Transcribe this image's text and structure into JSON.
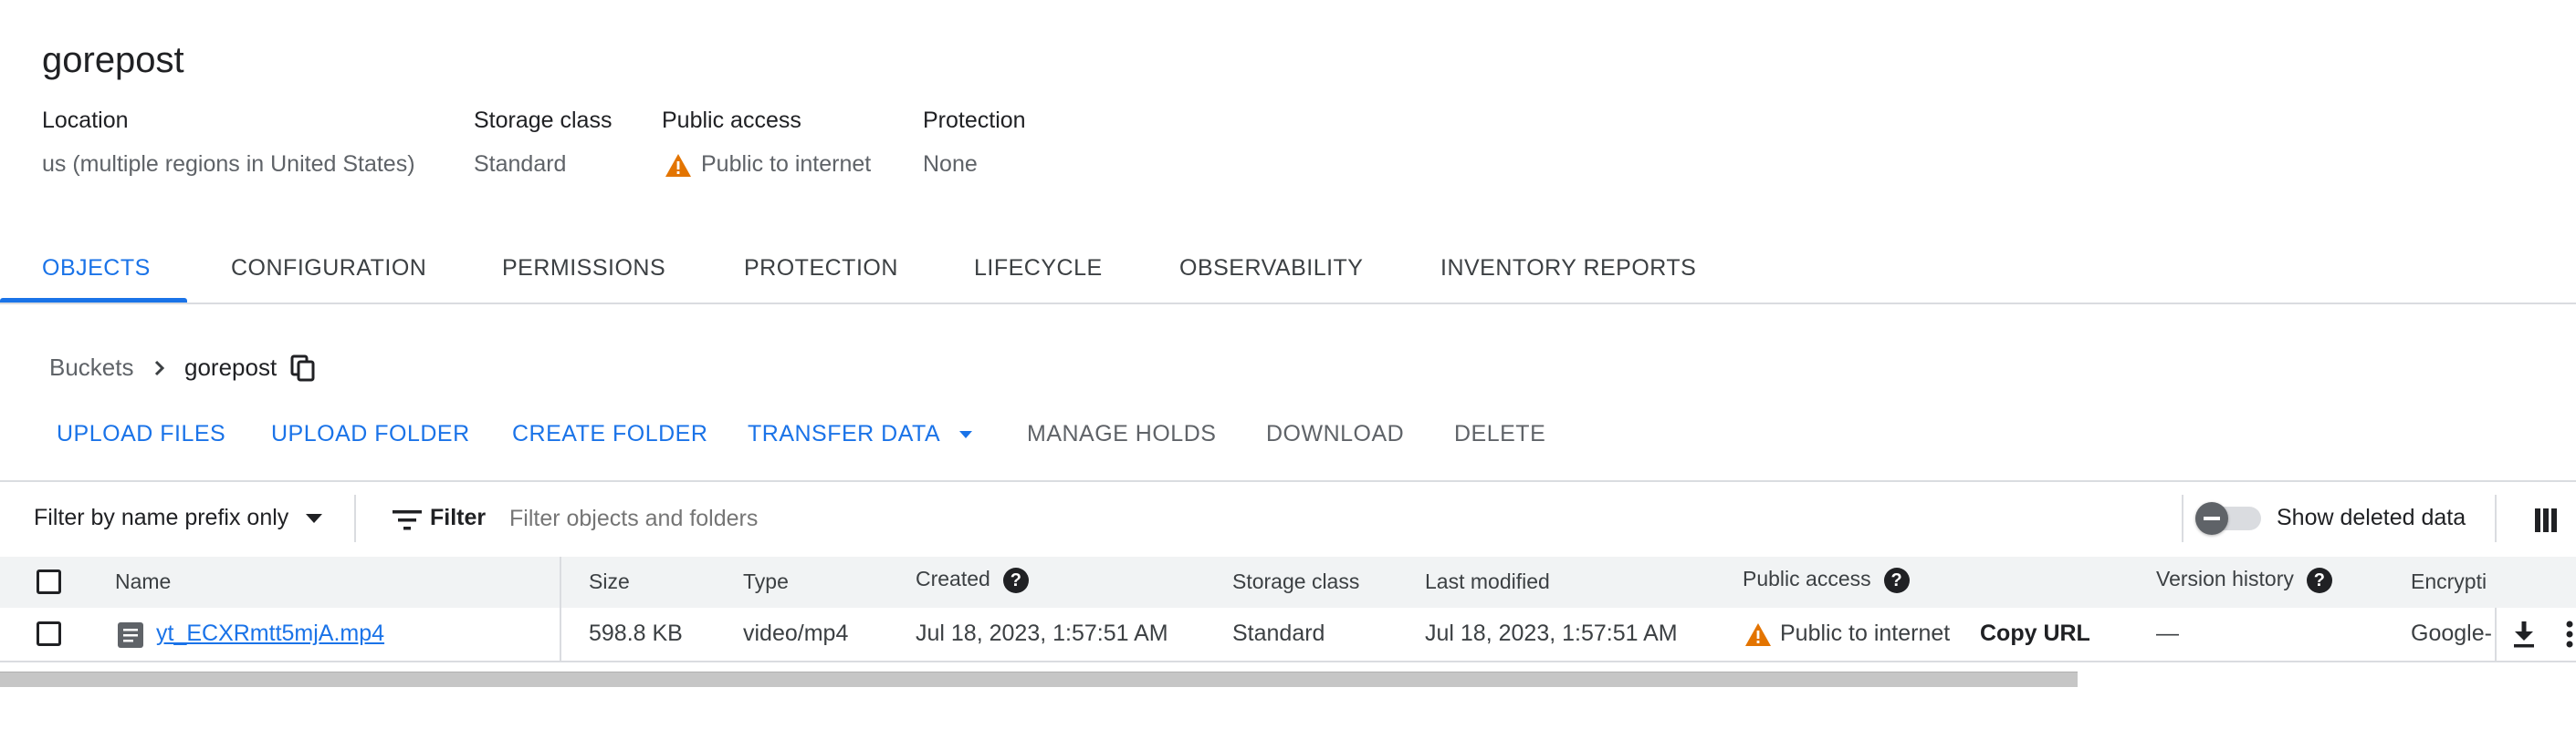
{
  "bucket": {
    "name": "gorepost",
    "meta": [
      {
        "label": "Location",
        "value": "us (multiple regions in United States)"
      },
      {
        "label": "Storage class",
        "value": "Standard"
      },
      {
        "label": "Public access",
        "value": "Public to internet"
      },
      {
        "label": "Protection",
        "value": "None"
      }
    ]
  },
  "tabs": [
    "OBJECTS",
    "CONFIGURATION",
    "PERMISSIONS",
    "PROTECTION",
    "LIFECYCLE",
    "OBSERVABILITY",
    "INVENTORY REPORTS"
  ],
  "breadcrumb": {
    "root": "Buckets",
    "current": "gorepost"
  },
  "actions": {
    "upload_files": "UPLOAD FILES",
    "upload_folder": "UPLOAD FOLDER",
    "create_folder": "CREATE FOLDER",
    "transfer_data": "TRANSFER DATA",
    "manage_holds": "MANAGE HOLDS",
    "download": "DOWNLOAD",
    "delete": "DELETE"
  },
  "filter": {
    "mode": "Filter by name prefix only",
    "label": "Filter",
    "placeholder": "Filter objects and folders",
    "show_deleted": "Show deleted data"
  },
  "columns": [
    "Name",
    "Size",
    "Type",
    "Created",
    "Storage class",
    "Last modified",
    "Public access",
    "Version history",
    "Encrypti"
  ],
  "rows": [
    {
      "name": "yt_ECXRmtt5mjA.mp4",
      "size": "598.8 KB",
      "type": "video/mp4",
      "created": "Jul 18, 2023, 1:57:51 AM",
      "storage_class": "Standard",
      "last_modified": "Jul 18, 2023, 1:57:51 AM",
      "public_access": "Public to internet",
      "copy_url": "Copy URL",
      "version_history": "—",
      "encryption": "Google-"
    }
  ],
  "colors": {
    "accent": "#1a73e8",
    "warning": "#e37400",
    "text": "#202124",
    "muted": "#5f6368"
  }
}
